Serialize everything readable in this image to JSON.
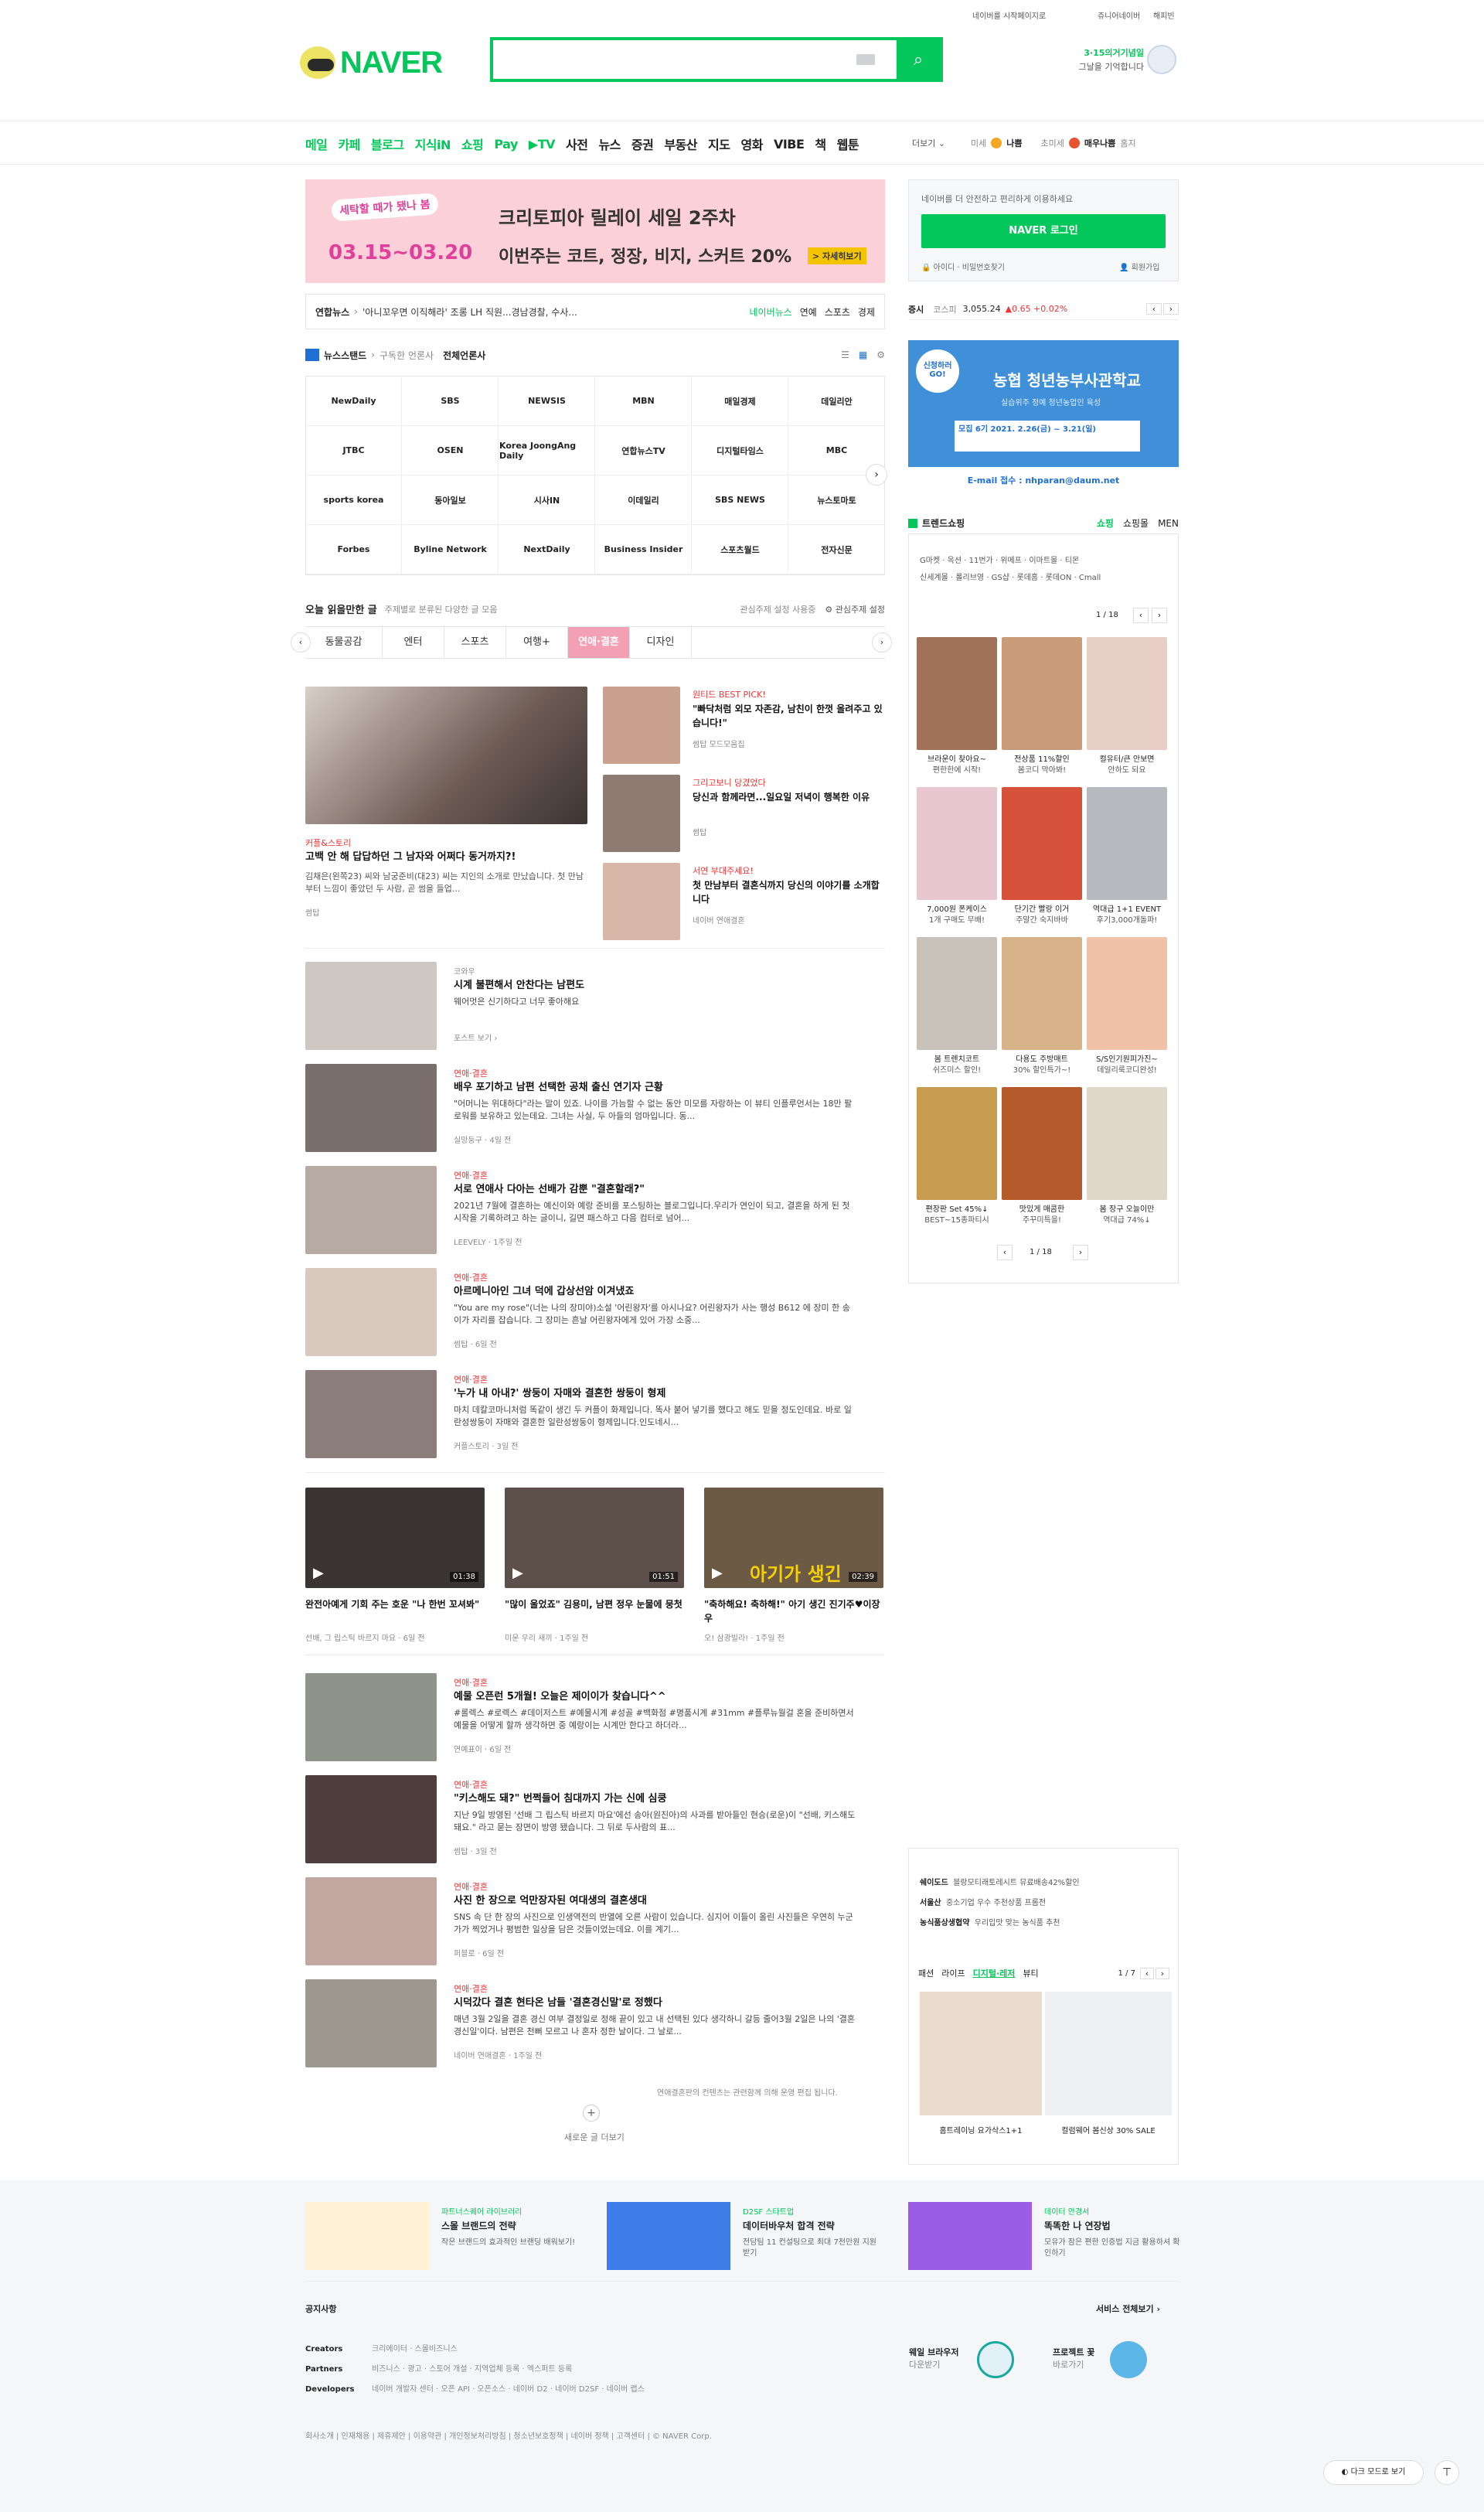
{
  "header": {
    "set_homepage": "네이버를 시작페이지로",
    "jr_naver": "쥬니어네이버",
    "happybean": "해피빈",
    "logo": "NAVER",
    "doodle_line1": "3·15의거기념일",
    "doodle_line2": "그날을 기억합니다"
  },
  "nav": [
    "메일",
    "카페",
    "블로그",
    "지식iN",
    "쇼핑",
    "Pay",
    "▶TV",
    "사전",
    "뉴스",
    "증권",
    "부동산",
    "지도",
    "영화",
    "VIBE",
    "책",
    "웹툰"
  ],
  "nav_more": "더보기",
  "weather": {
    "label1": "미세",
    "val1": "나쁨",
    "label2": "초미세",
    "val2": "매우나쁨",
    "place": "홈지"
  },
  "banner": {
    "badge": "세탁할 때가 됐나 봄",
    "date": "03.15~03.20",
    "brand": "크리토피아 릴레이 세일 2주차",
    "copy": "이번주는 코트, 정장, 비지, 스커트 20%",
    "cta": "> 자세히보기"
  },
  "news_ticker": {
    "source": "연합뉴스",
    "headline": "'아니꼬우면 이직해라' 조롱 LH 직원...경남경찰, 수사...",
    "tabs": [
      "네이버뉴스",
      "연예",
      "스포츠",
      "경제"
    ]
  },
  "newsstand": {
    "title": "뉴스스탠드",
    "subscribed": "구독한 언론사",
    "all": "전체언론사",
    "press": [
      "NewDaily",
      "SBS",
      "NEWSIS",
      "MBN",
      "매일경제",
      "데일리안",
      "JTBC",
      "OSEN",
      "Korea JoongAng Daily",
      "연합뉴스TV",
      "디지털타임스",
      "MBC",
      "sports korea",
      "동아일보",
      "시사IN",
      "이데일리",
      "SBS NEWS",
      "뉴스토마토",
      "Forbes",
      "Byline Network",
      "NextDaily",
      "Business Insider",
      "스포츠월드",
      "전자신문"
    ]
  },
  "today": {
    "title": "오늘 읽을만한 글",
    "sub": "주제별로 분류된 다양한 글 모음",
    "setting": "관심주제 설정 사용중",
    "setting2": "관심주제 설정",
    "tabs": [
      "동물공감",
      "엔터",
      "스포츠",
      "여행+",
      "연애·결혼",
      "디자인"
    ],
    "main_cat": "커플&스토리",
    "main_title": "고백 안 해 답답하던 그 남자와 어쩌다 동거까지?!",
    "main_desc": "김채은(왼쪽23) 씨와 남궁준비(대23) 씨는 지인의 소개로 만났습니다. 첫 만남부터 느낌이 좋았던 두 사람, 곧 썸을 들업...",
    "main_meta": "썸탑",
    "side": [
      {
        "cat": "원티드 BEST PICK!",
        "title": "\"빠닥처럼 외모 자존감, 남친이 한껏 올려주고 있습니다!\"",
        "meta": "썸탑 모드모음집"
      },
      {
        "cat": "그리고보니 당겼었다",
        "title": "당신과 함께라면...일요일 저녁이 행복한 이유",
        "meta": "썸탑"
      },
      {
        "cat": "서연 부대주세요!",
        "title": "첫 만남부터 결혼식까지 당신의 이야기를 소개합니다",
        "meta": "네이버 연애결혼"
      }
    ]
  },
  "list1": [
    {
      "src": "코와우",
      "title": "시계 불편해서 안찬다는 남편도",
      "desc": "웨어멋은 신기하다고 너무 좋아해요",
      "meta": "포스트 보기 ›"
    },
    {
      "cat": "연애·결혼",
      "title": "배우 포기하고 남편 선택한 공채 출신 연기자 근황",
      "desc": "\"어머니는 위대하다\"라는 말이 있죠. 나이를 가늠할 수 없는 동안 미모를 자랑하는 이 뷰티 인플루언서는 18만 팔로워를 보유하고 있는데요. 그녀는 사실, 두 아들의 엄마입니다. 동...",
      "meta": "실망둥구 · 4일 전"
    },
    {
      "cat": "연애·결혼",
      "title": "서로 연애사 다아는 선배가 감뿐 \"결혼할래?\"",
      "desc": "2021년 7월에 결혼하는 예신이와 예랑 준비를 포스팅하는 블로그입니다.우리가 연인이 되고, 결혼을 하게 된 첫 시작을 기록하려고 하는 글이니, 길면 패스하고 다음 컴터로 넘어...",
      "meta": "LEEVELY · 1주일 전"
    },
    {
      "cat": "연애·결혼",
      "title": "아르메니아인 그녀 덕에 갑상선암 이겨냈죠",
      "desc": "\"You are my rose\"(너는 나의 장미야)소설 '어린왕자'를 아시나요? 어린왕자가 사는 행성 B612 에 장미 한 송이가 자리를 잡습니다. 그 장미는 흔날 어린왕자에게 있어 가장 소중...",
      "meta": "썸탑 · 6일 전"
    },
    {
      "cat": "연애·결혼",
      "title": "'누가 내 아내?' 쌍둥이 자매와 결혼한 쌍둥이 형제",
      "desc": "마치 데칼코마니처럼 똑같이 생긴 두 커플이 화제입니다. 똑사 붙어 넣기를 했다고 해도 믿을 정도인데요. 바로 일란성쌍둥이 자매와 결혼한 일란성쌍둥이 형제입니다.인도네시...",
      "meta": "커플스토리 · 3일 전"
    }
  ],
  "videos": [
    {
      "dur": "01:38",
      "title": "완전아예게 기회 주는 호운 \"나 한번 꼬셔봐\"",
      "meta": "선배, 그 립스틱 바르지 마요 · 6일 전"
    },
    {
      "dur": "01:51",
      "title": "\"많이 울었죠\" 김용미, 남편 정우 눈물에 뭉첫",
      "meta": "미운 우리 새끼 · 1주일 전"
    },
    {
      "dur": "02:39",
      "title": "\"축하해요! 축하해!\" 아기 생긴 진기주♥이장우",
      "meta": "오! 삼광빌라! · 1주일 전"
    }
  ],
  "video_overlay": "아기가 생긴",
  "list2": [
    {
      "cat": "연애·결혼",
      "title": "예물 오픈런 5개월! 오늘은 제이이가 찾습니다^^",
      "desc": "#롤렉스 #로렉스 #데이저스트 #예물시계 #성골 #백화점 #명품시계 #31mm #플루뉴월걸 혼을 준비하면서 예물을 어떻게 할까 생각하면 중 예랑이는 시계만 한다고 하더라...",
      "meta": "연예표이 · 6일 전"
    },
    {
      "cat": "연애·결혼",
      "title": "\"키스해도 돼?\" 번쩍들어 침대까지 가는 신에 심쿵",
      "desc": "지난 9일 방영된 '선배 그 립스틱 바르지 마요'에선 송아(원진아)의 사과를 받아들인 현승(로운)이 \"선배, 키스해도 돼요.\" 라고 묻는 장면이 방영 됐습니다. 그 뒤로 두사람의 표...",
      "meta": "썸탑 · 3일 전"
    },
    {
      "cat": "연애·결혼",
      "title": "사진 한 장으로 억만장자된 여대생의 결혼생대",
      "desc": "SNS 속 단 한 장의 사진으로 인생역전의 반열에 오른 사람이 있습니다. 심지어 이들이 올린 사진들은 우연히 누군가가 찍었거나 평범한 일상을 담은 것들이었는데요. 이를 계기...",
      "meta": "퍼블로 · 6일 전"
    },
    {
      "cat": "연애·결혼",
      "title": "시덕갔다 결혼 현타온 남들 '결혼경신말'로 정했다",
      "desc": "매년 3월 2일을 결혼 경신 여부 결정일로 정해 끝이 있고 내 선택된 있다 생각하니 갈등 줄어3월 2일은 나의 '결혼경신일'이다. 남편은 천뻐 모르고 나 혼자 정한 날이다. 그 날로...",
      "meta": "네이버 연애결혼 · 1주일 전"
    }
  ],
  "bottom_note": "연애결혼판의 컨텐츠는 관련함께 의해 운영 편집 됩니다.",
  "more_btn": "새로운 글 더보기",
  "login": {
    "desc": "네이버를 더 안전하고 편리하게 이용하세요",
    "btn": "NAVER 로그인",
    "find_id": "아이디",
    "find_pw": "비밀번호찾기",
    "signup": "회원가입"
  },
  "stock": {
    "label": "증시",
    "idx": "코스피",
    "val": "3,055.24",
    "chg": "▲0.65 +0.02%"
  },
  "ad": {
    "l1": "신청하러 GO!",
    "l2": "농협 청년농부사관학교",
    "l3": "실습위주 정예 청년농업인 육성",
    "l4": "모집 6기 2021. 2.26(금) ~ 3.21(일)",
    "l5": "E-mail 접수 : nhparan@daum.net"
  },
  "trend": {
    "title": "트렌드쇼핑",
    "tabs": [
      "쇼핑",
      "쇼핑몰",
      "MEN"
    ],
    "rows": [
      "G마켓 · 옥션 · 11번가 · 위메프 · 이마트몰 · 티몬",
      "신세계몰 · 롤리브영 · GS샵 · 롯데홈 · 롯데ON · Cmall"
    ],
    "page": "1 / 18",
    "items": [
      {
        "t": "브라운이 찾아요~",
        "s": "편한한에 시작!"
      },
      {
        "t": "전상품 11%할인",
        "s": "봄코디 막아봐!"
      },
      {
        "t": "컬유터/큰 안보면",
        "s": "안하도 되요"
      },
      {
        "t": "7,000원 폰케이스",
        "s": "1개 구매도 무배!"
      },
      {
        "t": "단기간 빨랑 이거",
        "s": "주말간 숙지바바"
      },
      {
        "t": "역대급 1+1 EVENT",
        "s": "후기3,000개돌파!"
      },
      {
        "t": "봄 트렌치코트",
        "s": "쉬즈미스 할인!"
      },
      {
        "t": "다용도 주방매트",
        "s": "30% 할인특가~!"
      },
      {
        "t": "S/S인기원피가진~",
        "s": "데일리룩코디완성!"
      },
      {
        "t": "편장판 Set 45%↓",
        "s": "BEST~15종파티시"
      },
      {
        "t": "맛있게 매콤한",
        "s": "주꾸미특을!"
      },
      {
        "t": "봄 장구 오늘이만",
        "s": "역대급 74%↓"
      }
    ]
  },
  "right_list": [
    {
      "a": "쉐이도드",
      "b": "블랑모티래토레시트 뮤료배송42%할인"
    },
    {
      "a": "서울산",
      "b": "중소기업 우수 주천상품 프롬전"
    },
    {
      "a": "농식품상생협약",
      "b": "우리입맛 맞는 농식품 추천"
    }
  ],
  "fashion": {
    "tabs": [
      "패션",
      "라이프",
      "디지털·레저",
      "뷰티"
    ],
    "page": "1 / 7",
    "i1": "홈트레이닝 요가삭스1+1",
    "i2": "컬럼웨어 봄신상 30% SALE"
  },
  "promo": [
    {
      "cat": "파트너스퀘어 라이브러리",
      "title": "스몰 브랜드의 전략",
      "desc": "작은 브랜드의 효과적인 브랜딩 배워보기!"
    },
    {
      "cat": "D2SF 스타트업",
      "title": "데이터바우처 합격 전략",
      "desc": "전담팀 11 컨설팅으로 최대 7천만원 지원받기"
    },
    {
      "cat": "데이터 안경서",
      "title": "똑똑한 나 연장법",
      "desc": "모유가 잠은 편한 인증법 지금 활용하셔 확인하기"
    }
  ],
  "notice": "공지사항",
  "service_all": "서비스 전체보기",
  "footer_links": {
    "Creators": "크리에이터 · 스몰비즈니스",
    "Partners": "비즈니스 · 광고 · 스토어 개설 · 지역업체 등록 · 엑스퍼트 등록",
    "Developers": "네이버 개발자 센터 · 오픈 API · 오픈소스 · 네이버 D2 · 네이버 D2SF · 네이버 랩스"
  },
  "whale": {
    "t": "웨일 브라우저",
    "s": "다운받기"
  },
  "protect": {
    "t": "프로젝트 꽃",
    "s": "바로가기"
  },
  "bottom_links": "회사소개 | 인재채용 | 제휴제안 | 이용약관 | 개인정보처리방침 | 청소년보호정책 | 네이버 정책 | 고객센터 | © NAVER Corp.",
  "dark_mode": "다크 모드로 보기",
  "colors": {
    "brand": "#03c75a",
    "accent_red": "#e33",
    "banner_bg": "#fbd0d8"
  }
}
